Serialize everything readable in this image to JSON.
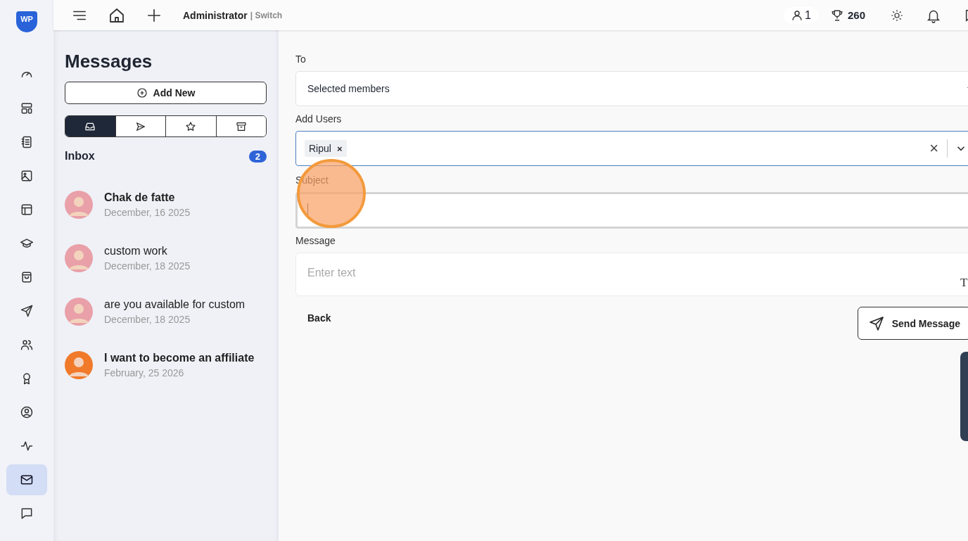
{
  "logo": {
    "text": "WP"
  },
  "rail": {
    "items": [
      {
        "selected": false
      },
      {
        "selected": false
      },
      {
        "selected": false
      },
      {
        "selected": false
      },
      {
        "selected": false
      },
      {
        "selected": false
      },
      {
        "selected": false
      },
      {
        "selected": false
      },
      {
        "selected": false
      },
      {
        "selected": false
      },
      {
        "selected": false
      },
      {
        "selected": false
      },
      {
        "selected": true
      },
      {
        "selected": false
      }
    ]
  },
  "topbar": {
    "role": "Administrator",
    "switch": "| Switch",
    "users_count": "1",
    "points": "260"
  },
  "messages": {
    "title": "Messages",
    "add_button": "Add New",
    "folders": [
      {
        "selected": true
      },
      {
        "selected": false
      },
      {
        "selected": false
      },
      {
        "selected": false
      }
    ],
    "folder_title": "Inbox",
    "unread_badge": "2",
    "items": [
      {
        "subject": "Chak de fatte",
        "date": "December, 16 2025",
        "unread": true,
        "color": "#e9a0a8"
      },
      {
        "subject": "custom work",
        "date": "December, 18 2025",
        "unread": false,
        "color": "#e9a0a8"
      },
      {
        "subject": "are you available for custom",
        "date": "December, 18 2025",
        "unread": false,
        "color": "#e9a0a8"
      },
      {
        "subject": "I want to become an affiliate",
        "date": "February, 25 2026",
        "unread": true,
        "color": "#f07a2a"
      }
    ]
  },
  "form": {
    "to_label": "To",
    "to_value": "Selected members",
    "users_label": "Add Users",
    "users": [
      {
        "name": "Ripul",
        "remove": "×"
      }
    ],
    "clear": "×",
    "subject_label": "Subject",
    "subject_focused": true,
    "message_label": "Message",
    "message_placeholder": "Enter text",
    "toolbar_glyph": "T",
    "back": "Back",
    "send": "Send Message"
  },
  "click_highlight": true,
  "side_panel_edge": true
}
